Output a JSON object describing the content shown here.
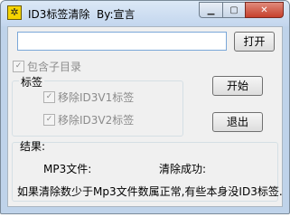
{
  "window": {
    "title": "ID3标签清除  By:宣言",
    "app_icon": "gear-icon"
  },
  "main": {
    "path_value": "",
    "open_button": "打开",
    "include_subdirs": {
      "label": "包含子目录",
      "checked": true,
      "enabled": false
    },
    "tag_group_label": "标签",
    "remove_v1": {
      "label": "移除ID3V1标签",
      "checked": true,
      "enabled": false
    },
    "remove_v2": {
      "label": "移除ID3V2标签",
      "checked": true,
      "enabled": false
    },
    "start_button": "开始",
    "exit_button": "退出"
  },
  "results": {
    "label": "结果:",
    "mp3_files_label": "MP3文件:",
    "cleared_success_label": "清除成功:",
    "note": "如果清除数少于Mp3文件数属正常,有些本身没ID3标签."
  }
}
